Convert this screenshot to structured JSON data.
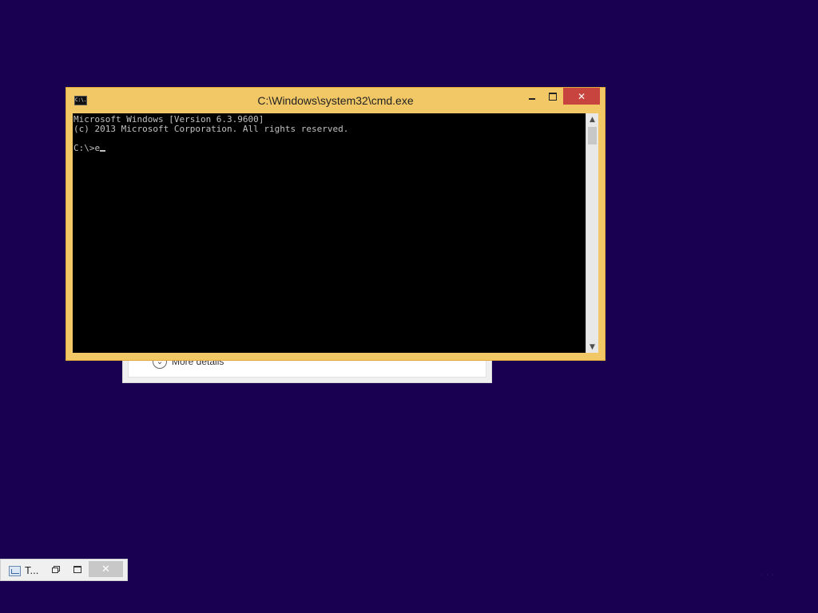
{
  "desktop": {
    "background_color": "#1a0050"
  },
  "background_window": {
    "more_details_icon": "chevron-down-icon",
    "more_details_label": "More details"
  },
  "cmd": {
    "title": "C:\\Windows\\system32\\cmd.exe",
    "app_icon_text": "C:\\.",
    "buttons": {
      "minimize": "minimize-icon",
      "maximize": "maximize-icon",
      "close_glyph": "✕"
    },
    "accent_color": "#f2c866",
    "close_color": "#c7453e",
    "console_lines": [
      "Microsoft Windows [Version 6.3.9600]",
      "(c) 2013 Microsoft Corporation. All rights reserved.",
      "",
      "C:\\>e"
    ],
    "scroll_up_glyph": "▲",
    "scroll_down_glyph": "▼"
  },
  "minimized_window": {
    "title": "T...",
    "close_glyph": "✕"
  },
  "tray_dots": "· · ·"
}
